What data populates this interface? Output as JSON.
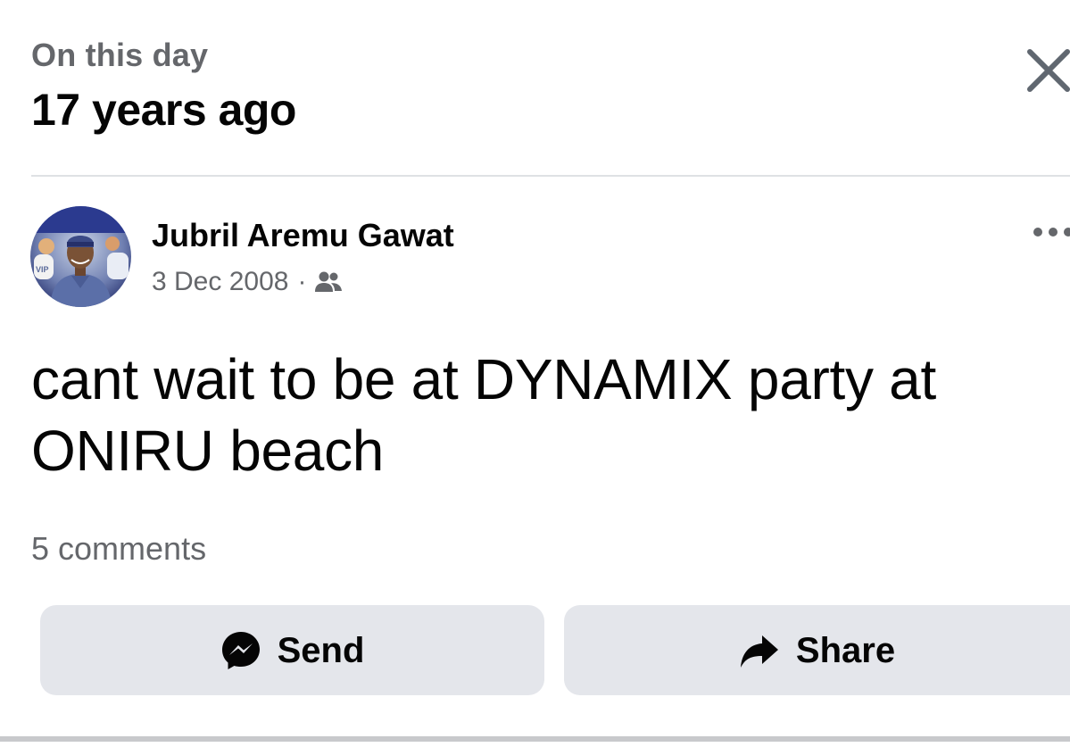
{
  "header": {
    "label": "On this day",
    "title": "17 years ago",
    "close_icon": "close-icon"
  },
  "post": {
    "author": "Jubril Aremu Gawat",
    "date": "3 Dec 2008",
    "separator": "·",
    "audience_icon": "friends-icon",
    "more_icon": "more-options-icon",
    "text": "cant wait to be at DYNAMIX party at ONIRU beach",
    "comments": "5 comments"
  },
  "actions": {
    "send_label": "Send",
    "send_icon": "messenger-icon",
    "share_label": "Share",
    "share_icon": "share-arrow-icon"
  },
  "colors": {
    "primary_text": "#050505",
    "secondary_text": "#65676b",
    "button_bg": "#e4e6eb",
    "divider": "#dfe1e4"
  }
}
